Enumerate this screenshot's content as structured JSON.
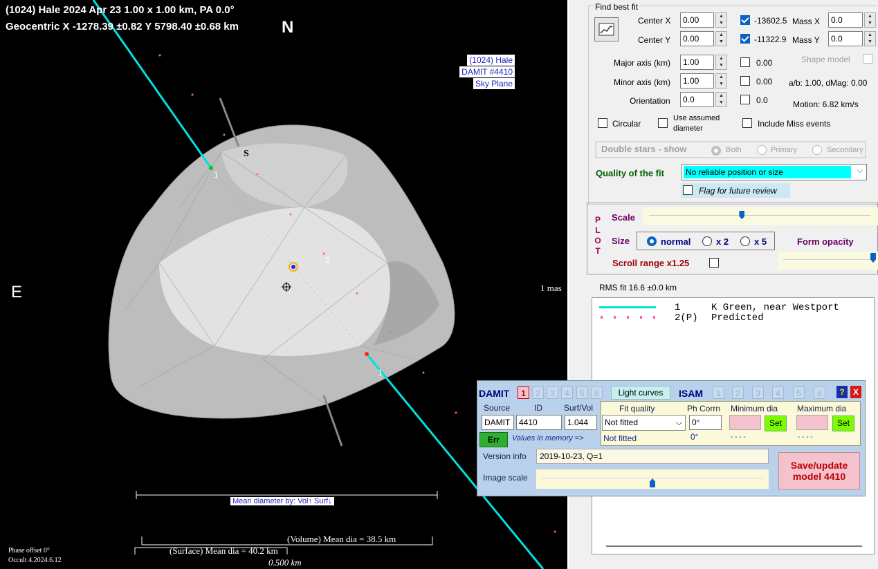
{
  "plot": {
    "title_line1": "(1024) Hale 2024 Apr 23  1.00 x 1.00 km, PA 0.0°",
    "title_line2": "Geocentric X  -1278.39 ±0.82  Y 5798.40 ±0.68 km",
    "north_label": "N",
    "east_label": "E",
    "south_label": "S",
    "info_box": [
      "(1024) Hale",
      "DAMIT #4410",
      "Sky Plane"
    ],
    "chord_label_1": "1",
    "chord_label_1b": "1",
    "chord_label_2": "2",
    "scale_mas": "1 mas",
    "mean_dia_by": "Mean diameter by: Vol↑ Surf↓",
    "volume_dia": "(Volume) Mean dia = 38.5 km",
    "surface_dia": "(Surface) Mean dia = 40.2 km",
    "scale_km": "0.500 km",
    "phase_offset": "Phase offset 0°",
    "version": "Occult 4.2024.6.12"
  },
  "fit": {
    "find_best_fit": "Find best fit",
    "center_x_label": "Center X",
    "center_x_value": "0.00",
    "center_x_readout": "-13602.5",
    "center_y_label": "Center Y",
    "center_y_value": "0.00",
    "center_y_readout": "-11322.9",
    "mass_x_label": "Mass X",
    "mass_x_value": "0.0",
    "mass_y_label": "Mass Y",
    "mass_y_value": "0.0",
    "major_label": "Major axis (km)",
    "major_value": "1.00",
    "major_readout": "0.00",
    "minor_label": "Minor axis (km)",
    "minor_value": "1.00",
    "minor_readout": "0.00",
    "orient_label": "Orientation",
    "orient_value": "0.0",
    "orient_readout": "0.0",
    "shape_model": "Shape model",
    "ab_dmag": "a/b: 1.00, dMag: 0.00",
    "motion": "Motion: 6.82 km/s",
    "circular": "Circular",
    "use_assumed": "Use assumed diameter",
    "include_miss": "Include Miss events",
    "double_stars": "Double stars - show",
    "both": "Both",
    "primary": "Primary",
    "secondary": "Secondary",
    "quality_label": "Quality of the fit",
    "quality_value": "No reliable position or size",
    "flag_review": "Flag for future review"
  },
  "plotpanel": {
    "letters": [
      "P",
      "L",
      "O",
      "T"
    ],
    "scale": "Scale",
    "size": "Size",
    "normal": "normal",
    "x2": "x 2",
    "x5": "x 5",
    "form_opacity": "Form opacity",
    "scroll_range": "Scroll range x1.25",
    "scale_level": 0.42,
    "opacity_level": 1.0
  },
  "rms": "RMS fit 16.6 ±0.0 km",
  "legend": [
    {
      "num": "1",
      "text": "K Green, near Westport"
    },
    {
      "num": "2(P)",
      "text": "Predicted"
    }
  ],
  "damit": {
    "title": "DAMIT",
    "models": [
      "1",
      "2",
      "3",
      "4",
      "5",
      "6"
    ],
    "light_curves": "Light curves",
    "isam": "ISAM",
    "isam_models": [
      "1",
      "2",
      "3",
      "4",
      "5",
      "6"
    ],
    "help": "?",
    "close": "X",
    "source_hdr": "Source",
    "id_hdr": "ID",
    "surfvol_hdr": "Surf/Vol",
    "fit_quality_hdr": "Fit quality",
    "ph_corr_hdr": "Ph Corrn",
    "min_dia_hdr": "Minimum dia",
    "max_dia_hdr": "Maximum dia",
    "source": "DAMIT",
    "id": "4410",
    "surfvol": "1.044",
    "fit_quality": "Not fitted",
    "ph_corr": "0°",
    "set": "Set",
    "err": "Err",
    "values_in_memory": "Values in memory =>",
    "mem_fit": "Not fitted",
    "mem_ph": "0°",
    "mem_min": "- - - -",
    "mem_max": "- - - -",
    "version_label": "Version info",
    "version_value": "2019-10-23, Q=1",
    "image_scale": "Image scale",
    "image_scale_level": 0.5,
    "save_btn": "Save/update model 4410"
  },
  "colors": {
    "chord": "#00e0e0",
    "predicted": "#ff5fa0",
    "highlight": "#00ffff",
    "save_bg": "#f4c2cc",
    "save_text": "#c00000",
    "set_bg": "#7cfc00"
  }
}
